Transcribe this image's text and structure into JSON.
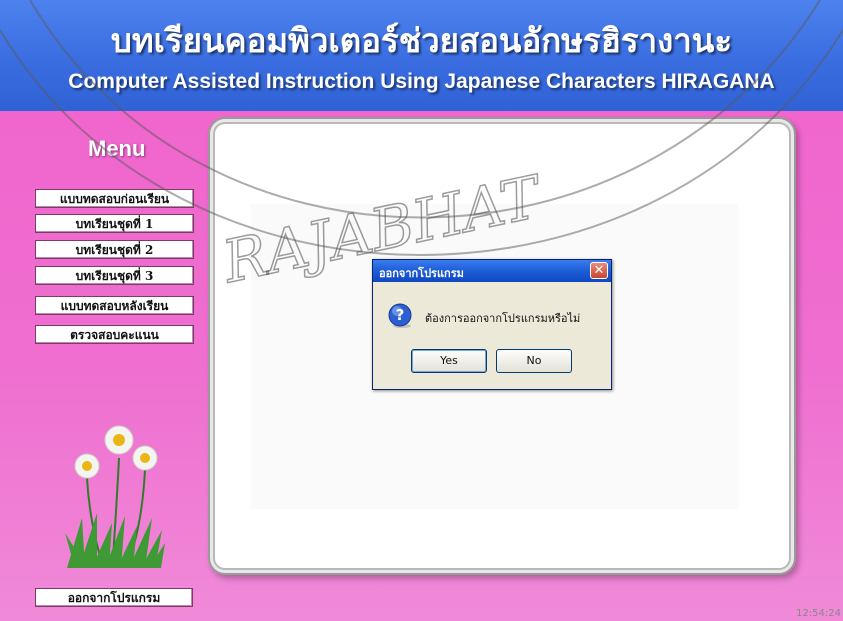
{
  "header": {
    "title_th": "บทเรียนคอมพิวเตอร์ช่วยสอนอักษรฮิรางานะ",
    "title_en": "Computer Assisted Instruction Using Japanese Characters HIRAGANA"
  },
  "menu": {
    "heading": "Menu",
    "items": [
      {
        "label": "แบบทดสอบก่อนเรียน"
      },
      {
        "label": "บทเรียนชุดที่ 1"
      },
      {
        "label": "บทเรียนชุดที่ 2"
      },
      {
        "label": "บทเรียนชุดที่ 3"
      },
      {
        "label": "แบบทดสอบหลังเรียน"
      },
      {
        "label": "ตรวจสอบคะแนน"
      }
    ],
    "exit_label": "ออกจากโปรแกรม"
  },
  "dialog": {
    "title": "ออกจากโปรแกรม",
    "message": "ต้องการออกจากโปรแกรมหรือไม่",
    "yes_label": "Yes",
    "no_label": "No",
    "close_glyph": "✕",
    "icon": "question-icon"
  },
  "watermark": {
    "text": "RAJABHAT"
  },
  "status": {
    "clock": "12:54:24"
  },
  "colors": {
    "header_blue": "#3a6de0",
    "page_pink": "#ef6fd0",
    "dialog_title_blue": "#1f5fd8"
  }
}
